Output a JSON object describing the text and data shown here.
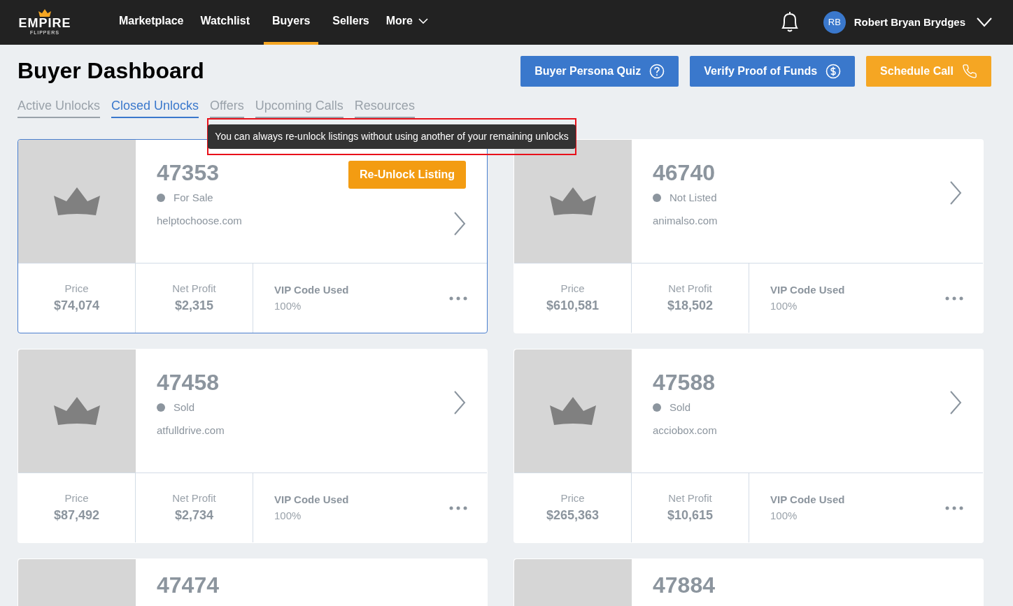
{
  "brand": {
    "name": "EMPIRE",
    "tagline": "FLIPPERS"
  },
  "nav": [
    {
      "label": "Marketplace",
      "selected": false
    },
    {
      "label": "Watchlist",
      "selected": false
    },
    {
      "label": "Buyers",
      "selected": true
    },
    {
      "label": "Sellers",
      "selected": false
    },
    {
      "label": "More",
      "selected": false,
      "dropdown": true
    }
  ],
  "user": {
    "initials": "RB",
    "name": "Robert Bryan Brydges"
  },
  "page_title": "Buyer Dashboard",
  "actions": [
    {
      "label": "Buyer Persona Quiz",
      "kind": "quiz"
    },
    {
      "label": "Verify Proof of Funds",
      "kind": "funds"
    },
    {
      "label": "Schedule Call",
      "kind": "call"
    }
  ],
  "tabs": [
    {
      "label": "Active Unlocks",
      "selected": false
    },
    {
      "label": "Closed Unlocks",
      "selected": true
    },
    {
      "label": "Offers",
      "selected": false
    },
    {
      "label": "Upcoming Calls",
      "selected": false
    },
    {
      "label": "Resources",
      "selected": false
    }
  ],
  "tooltip": "You can always re-unlock listings without using another of your remaining unlocks",
  "listings": [
    {
      "number": "47353",
      "status": "For Sale",
      "domain": "helptochoose.com",
      "hovered": true,
      "action": "Re-Unlock Listing",
      "price_label": "Price",
      "price": "$74,074",
      "profit_label": "Net Profit",
      "profit": "$2,315",
      "vip_label": "VIP Code Used",
      "vip": "100%"
    },
    {
      "number": "46740",
      "status": "Not Listed",
      "domain": "animalso.com",
      "hovered": false,
      "price_label": "Price",
      "price": "$610,581",
      "profit_label": "Net Profit",
      "profit": "$18,502",
      "vip_label": "VIP Code Used",
      "vip": "100%"
    },
    {
      "number": "47458",
      "status": "Sold",
      "domain": "atfulldrive.com",
      "hovered": false,
      "price_label": "Price",
      "price": "$87,492",
      "profit_label": "Net Profit",
      "profit": "$2,734",
      "vip_label": "VIP Code Used",
      "vip": "100%"
    },
    {
      "number": "47588",
      "status": "Sold",
      "domain": "acciobox.com",
      "hovered": false,
      "price_label": "Price",
      "price": "$265,363",
      "profit_label": "Net Profit",
      "profit": "$10,615",
      "vip_label": "VIP Code Used",
      "vip": "100%"
    },
    {
      "number": "47474",
      "hovered": false
    },
    {
      "number": "47884",
      "hovered": false
    }
  ]
}
